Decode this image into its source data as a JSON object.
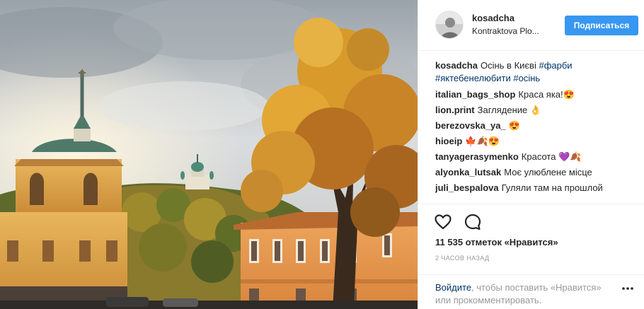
{
  "header": {
    "username": "kosadcha",
    "location": "Kontraktova Plo...",
    "follow_label": "Подписаться"
  },
  "caption": {
    "username": "kosadcha",
    "text": "Осінь в Києві",
    "tags": [
      "#фарби",
      "#яктебенелюбити",
      "#осінь"
    ]
  },
  "comments": [
    {
      "username": "italian_bags_shop",
      "text": "Краса яка!😍"
    },
    {
      "username": "lion.print",
      "text": "Заглядение 👌"
    },
    {
      "username": "berezovska_ya_",
      "text": "😍"
    },
    {
      "username": "hioeip",
      "text": "🍁🍂😍"
    },
    {
      "username": "tanyagerasymenko",
      "text": "Красота 💜🍂"
    },
    {
      "username": "alyonka_lutsak",
      "text": "Моє улюблене місце"
    },
    {
      "username": "juli_bespalova",
      "text": "Гуляли там на прошлой"
    }
  ],
  "actions": {
    "likes": "11 535 отметок «Нравится»",
    "time": "2 ЧАСОВ НАЗАД"
  },
  "login": {
    "link_text": "Войдите",
    "rest_text": ", чтобы поставить «Нравится» или прокомментировать."
  },
  "icons": {
    "like": "heart-icon",
    "comment": "comment-bubble-icon",
    "more": "more-dots-icon"
  },
  "colors": {
    "accent": "#3897f0",
    "link": "#003569",
    "muted": "#999999"
  }
}
